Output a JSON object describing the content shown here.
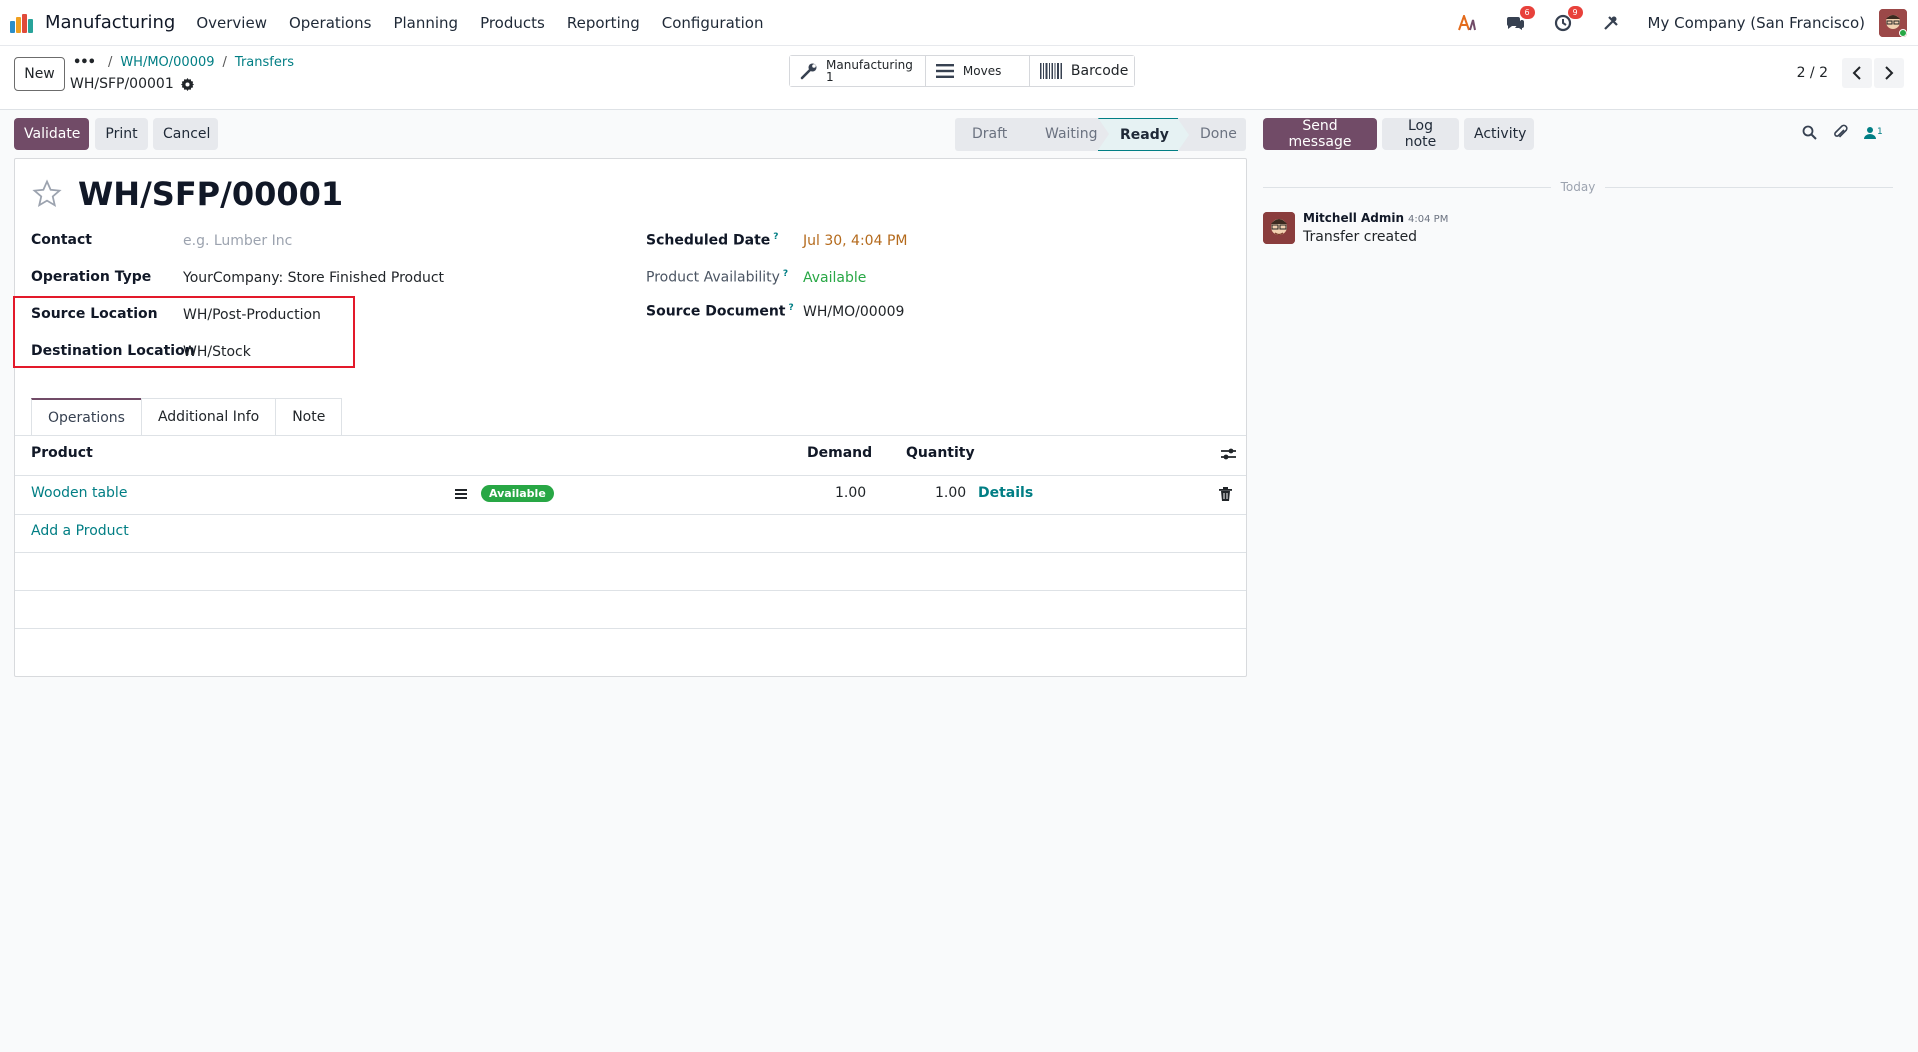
{
  "navbar": {
    "app_name": "Manufacturing",
    "menu": [
      "Overview",
      "Operations",
      "Planning",
      "Products",
      "Reporting",
      "Configuration"
    ],
    "messages_count": "6",
    "activities_count": "9",
    "company": "My Company (San Francisco)"
  },
  "control": {
    "new_label": "New",
    "breadcrumb_dots": "•••",
    "breadcrumb": [
      "WH/MO/00009",
      "Transfers"
    ],
    "record": "WH/SFP/00001",
    "smart_buttons": {
      "manufacturing_label": "Manufacturing",
      "manufacturing_count": "1",
      "moves_label": "Moves",
      "barcode_label": "Barcode"
    },
    "pager": "2 / 2"
  },
  "actions": {
    "validate": "Validate",
    "print": "Print",
    "cancel": "Cancel"
  },
  "status": {
    "stages": [
      "Draft",
      "Waiting",
      "Ready",
      "Done"
    ],
    "active": "Ready"
  },
  "form": {
    "title": "WH/SFP/00001",
    "contact_label": "Contact",
    "contact_placeholder": "e.g. Lumber Inc",
    "operation_type_label": "Operation Type",
    "operation_type": "YourCompany: Store Finished Product",
    "source_location_label": "Source Location",
    "source_location": "WH/Post-Production",
    "destination_location_label": "Destination Location",
    "destination_location": "WH/Stock",
    "scheduled_date_label": "Scheduled Date",
    "scheduled_date": "Jul 30, 4:04 PM",
    "product_availability_label": "Product Availability",
    "product_availability": "Available",
    "source_document_label": "Source Document",
    "source_document": "WH/MO/00009",
    "help_mark": "?"
  },
  "tabs": [
    "Operations",
    "Additional Info",
    "Note"
  ],
  "table": {
    "headers": {
      "product": "Product",
      "demand": "Demand",
      "quantity": "Quantity"
    },
    "rows": [
      {
        "product": "Wooden table",
        "badge": "Available",
        "demand": "1.00",
        "quantity": "1.00",
        "details": "Details"
      }
    ],
    "add_product": "Add a Product"
  },
  "chatter": {
    "send_message": "Send message",
    "log_note": "Log note",
    "activity": "Activity",
    "followers_count": "1",
    "date_separator": "Today",
    "messages": [
      {
        "author": "Mitchell Admin",
        "time": "4:04 PM",
        "body": "Transfer created"
      }
    ]
  },
  "colors": {
    "primary": "#714b67",
    "link": "#017e84",
    "success": "#28a745",
    "warning_date": "#b46a1c",
    "highlight": "#e3192a"
  }
}
